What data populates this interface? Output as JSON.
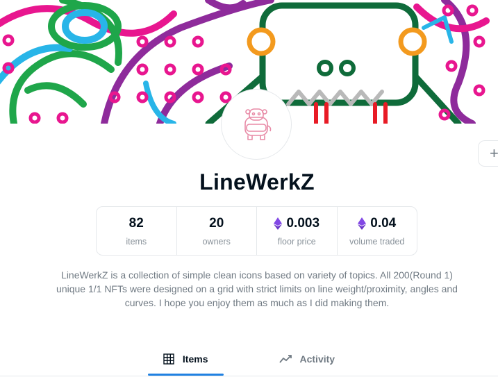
{
  "collection": {
    "name": "LineWerkZ",
    "description": "LineWerkZ is a collection of simple clean icons based on variety of topics. All 200(Round 1) unique 1/1 NFTs were designed on a grid with strict limits on line weight/proximity, angles and curves. I hope you enjoy them as much as I did making them."
  },
  "stats": [
    {
      "value": "82",
      "label": "items",
      "eth": false
    },
    {
      "value": "20",
      "label": "owners",
      "eth": false
    },
    {
      "value": "0.003",
      "label": "floor price",
      "eth": true
    },
    {
      "value": "0.04",
      "label": "volume traded",
      "eth": true
    }
  ],
  "side_button": {
    "label": "+"
  },
  "tabs": [
    {
      "label": "Items",
      "icon": "grid-icon",
      "active": true
    },
    {
      "label": "Activity",
      "icon": "activity-chart-icon",
      "active": false
    }
  ],
  "colors": {
    "accent": "#2081e2",
    "eth": "#8248e5",
    "text": "#04111d",
    "muted": "#707a83"
  }
}
